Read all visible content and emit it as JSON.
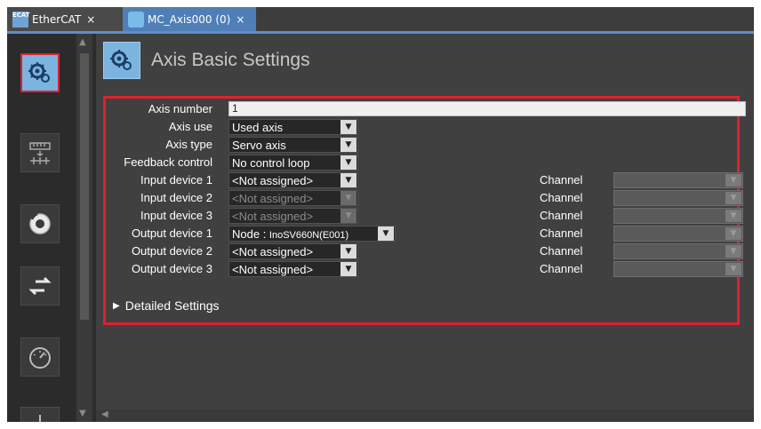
{
  "tabs": [
    {
      "label": "EtherCAT",
      "icon": "ethercat-icon",
      "close": "×"
    },
    {
      "label": "MC_Axis000 (0)",
      "icon": "axis-gear-icon",
      "close": "×"
    }
  ],
  "heading": {
    "title": "Axis Basic Settings"
  },
  "form": {
    "axis_number": {
      "label": "Axis number",
      "value": "1"
    },
    "axis_use": {
      "label": "Axis use",
      "value": "Used axis"
    },
    "axis_type": {
      "label": "Axis type",
      "value": "Servo axis"
    },
    "feedback_control": {
      "label": "Feedback control",
      "value": "No control loop"
    },
    "devices": [
      {
        "label": "Input device 1",
        "value": "<Not assigned>",
        "enabled": true,
        "channel_label": "Channel"
      },
      {
        "label": "Input device 2",
        "value": "<Not assigned>",
        "enabled": false,
        "channel_label": "Channel"
      },
      {
        "label": "Input device 3",
        "value": "<Not assigned>",
        "enabled": false,
        "channel_label": "Channel"
      },
      {
        "label": "Output device 1",
        "value_prefix": "Node : ",
        "value": "InoSV660N(E001)",
        "enabled": true,
        "channel_label": "Channel"
      },
      {
        "label": "Output device 2",
        "value": "<Not assigned>",
        "enabled": true,
        "channel_label": "Channel"
      },
      {
        "label": "Output device 3",
        "value": "<Not assigned>",
        "enabled": true,
        "channel_label": "Channel"
      }
    ],
    "detailed_settings": "Detailed Settings"
  },
  "colors": {
    "highlight": "#e0202e",
    "accent": "#5c8fc8",
    "icon_blue": "#7ab4df"
  }
}
